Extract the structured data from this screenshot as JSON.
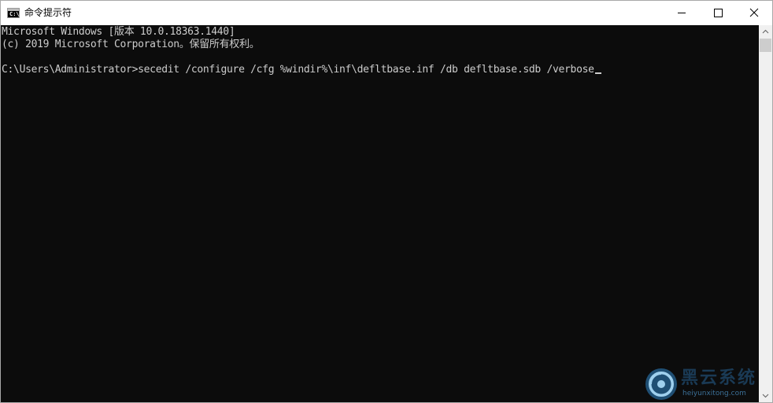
{
  "window": {
    "title": "命令提示符",
    "icon": "cmd-icon",
    "icon_glyph": "C:\\."
  },
  "console": {
    "lines": [
      "Microsoft Windows [版本 10.0.18363.1440]",
      "(c) 2019 Microsoft Corporation。保留所有权利。",
      "C:\\Users\\Administrator>secedit /configure /cfg %windir%\\inf\\defltbase.inf /db defltbase.sdb /verbose"
    ]
  },
  "watermark": {
    "brand": "黑云系统",
    "url": "heiyunxitong.com"
  },
  "colors": {
    "console_bg": "#0c0c0c",
    "console_fg": "#cccccc",
    "titlebar_bg": "#ffffff",
    "scrollbar_bg": "#f0f0f0"
  }
}
